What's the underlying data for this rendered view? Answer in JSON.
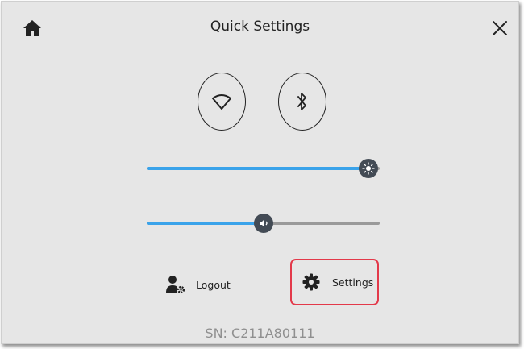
{
  "header": {
    "title": "Quick Settings",
    "home_icon": "home-icon",
    "close_icon": "close-icon"
  },
  "toggles": [
    {
      "name": "wifi",
      "icon": "wifi-icon"
    },
    {
      "name": "bluetooth",
      "icon": "bluetooth-icon"
    }
  ],
  "sliders": {
    "brightness": {
      "icon": "brightness-icon",
      "value_fraction": 0.95
    },
    "volume": {
      "icon": "volume-icon",
      "value_fraction": 0.5
    }
  },
  "actions": {
    "logout_label": "Logout",
    "logout_icon": "user-gear-icon",
    "settings_label": "Settings",
    "settings_icon": "gear-icon"
  },
  "footer": {
    "serial_number": "SN: C211A80111"
  },
  "colors": {
    "slider_fill": "#3aa3ea",
    "slider_track": "#9a9a9a",
    "thumb": "#434b55",
    "highlight_border": "#e3394a",
    "background": "#e6e6e6"
  }
}
